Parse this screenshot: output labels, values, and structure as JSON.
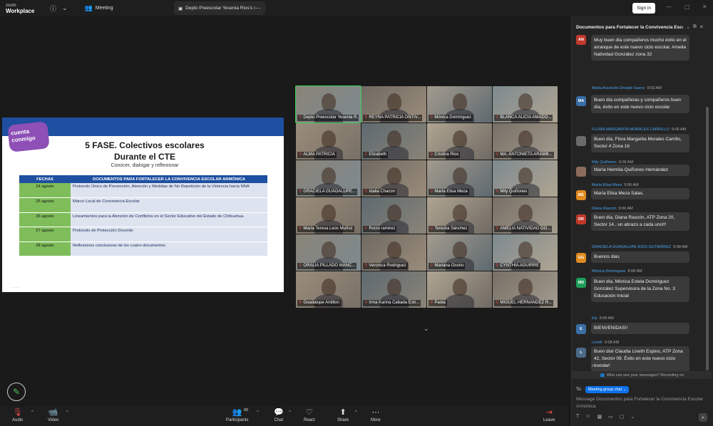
{
  "app": {
    "logo_line1": "zoom",
    "logo_line2": "Workplace",
    "meeting_label": "Meeting",
    "tab_title": "Depto Preescolar Yesenia Rios's sc",
    "signin": "Sign in"
  },
  "slide": {
    "badge": "cuenta conmigo",
    "title1": "5 FASE. Colectivos escolares",
    "title2": "Durante el CTE",
    "subtitle": "Conocer, dialogar y reflexionar",
    "col_dates": "FECHAS",
    "col_docs": "DOCUMENTOS PARA FORTALECER LA CONVIVENCIA ESCOLAR ARMÓNICA",
    "rows": [
      {
        "date": "24 agosto",
        "doc": "Protocolo Único de Prevención, Atención y Medidas de No Repetición de la Violencia hacia NNA"
      },
      {
        "date": "25 agosto",
        "doc": "Marco Local de Convivencia Escolar"
      },
      {
        "date": "26 agosto",
        "doc": "Lineamientos para la Atención de Conflictos en el Sector Educativo del Estado de Chihuahua."
      },
      {
        "date": "27 agosto",
        "doc": "Protocolo de Protección Docente"
      },
      {
        "date": "28 agosto",
        "doc": "Reflexiones conclusivas de los cuatro documentos"
      }
    ]
  },
  "participants": [
    "Depto Preescolar Yesenia R...",
    "REYNA PATRICIA ONTIV...",
    "Mónica Domínguez",
    "BLANCA ALICIA AMADO...",
    "ALMA PATRICIA",
    "Elizabeth",
    "Cristina Rios",
    "MA. ANTONIETA ARAMB...",
    "GRACIELA GUADALUPE...",
    "Idalia Chacon",
    "María Elisa Meza",
    "Mily Quiñones",
    "María Teresa Leos Muñoz",
    "Rocio ramirez",
    "Teresita Sánchez",
    "AMELIA NATIVIDAD GO...",
    "ORALIA PILLADO MANC...",
    "Veronica Rodriguez",
    "Mariana Osorio",
    "CYNTHIA AGUIRRE",
    "Guadalupe Antillon",
    "Irma Karina Cabada Estr...",
    "Paola",
    "MIGUEL HERNANDEZ R..."
  ],
  "chat": {
    "title": "Documentos para Fortalecer la Convivencia Escolar Armónica",
    "messages": [
      {
        "sender": "",
        "time": "",
        "initials": "AN",
        "color": "#c0392b",
        "text": "Muy buen día compañeros  mucho éxito en el arranque de este nuevo ciclo escolar. Amelia Natividad González zona 32"
      },
      {
        "sender": "María Asunción Dorado Saenz",
        "time": "9:03 AM",
        "initials": "MA",
        "color": "#3a6ea5",
        "text": "Buen día compañeras y compañeros buen día, éxito en este nuevo ciclo escolar"
      },
      {
        "sender": "FLORA MARGARITA MORALES CARRILLO",
        "time": "9:06 AM",
        "initials": "",
        "color": "#6b6b6b",
        "text": "Buen día, Flora Margarita Morales Carrillo, Sector 4 Zona 16"
      },
      {
        "sender": "Mily Quiñones",
        "time": "9:06 AM",
        "initials": "",
        "color": "#8a6d5a",
        "text": "María Hermila Quiñones Hernández"
      },
      {
        "sender": "María Elisa Meza",
        "time": "9:06 AM",
        "initials": "ME",
        "color": "#e08a1e",
        "text": "María Elisa Meza Salas."
      },
      {
        "sender": "Diana Rascón",
        "time": "9:06 AM",
        "initials": "DR",
        "color": "#c0392b",
        "text": "Buen día, Diana Rascón, ATP Zona 20, Sector 14.. un abrazo a cada uno!!!"
      },
      {
        "sender": "GRACIELA GUADALUPE RIOS GUTIERREZ",
        "time": "9:08 AM",
        "initials": "GG",
        "color": "#e08a1e",
        "text": "Buenos dias"
      },
      {
        "sender": "Mónica Domínguez",
        "time": "9:08 AM",
        "initials": "MD",
        "color": "#1e9e5a",
        "text": "Buen día, Mónica Estela Domínguez González Supervisora de la Zona No. 3 Educación Inicial"
      },
      {
        "sender": "Ely",
        "time": "9:08 AM",
        "initials": "E",
        "color": "#3a6ea5",
        "text": "BIENVENIDAS!!"
      },
      {
        "sender": "Lineth",
        "time": "9:08 AM",
        "initials": "L",
        "color": "#4a6a8a",
        "text": "Buen día! Claudia Lineth Espino, ATP Zona 42, Sector 09. Éxito en este nuevo ciclo escolar!"
      }
    ],
    "who_can_see": "Who can see your messages? Recording on",
    "to_label": "To:",
    "to_target": "Meeting group chat",
    "compose_placeholder": "Message Documentos para Fortalecer la Convivencia Escolar Armónica"
  },
  "toolbar": {
    "audio": "Audio",
    "video": "Video",
    "participants": "Participants",
    "participants_count": "88",
    "chat": "Chat",
    "react": "React",
    "share": "Share",
    "more": "More",
    "leave": "Leave"
  }
}
